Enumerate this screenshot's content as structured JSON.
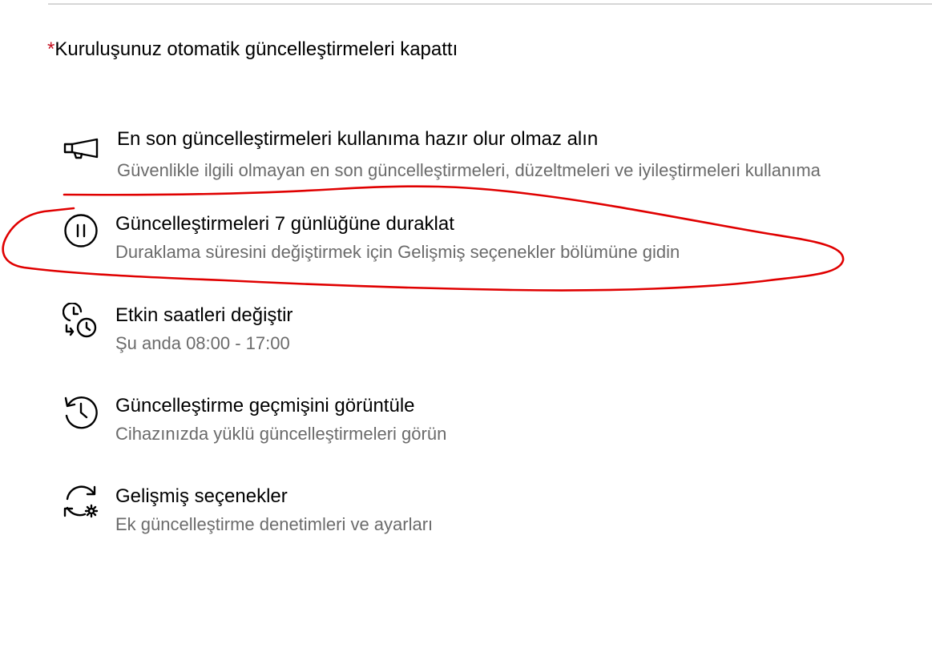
{
  "notice": {
    "asterisk": "*",
    "text": "Kuruluşunuz otomatik güncelleştirmeleri kapattı"
  },
  "options": [
    {
      "icon": "megaphone-icon",
      "title": "En son güncelleştirmeleri kullanıma hazır olur olmaz alın",
      "description": "Güvenlikle ilgili olmayan en son güncelleştirmeleri, düzeltmeleri ve iyileştirmeleri kullanıma"
    },
    {
      "icon": "pause-icon",
      "title": "Güncelleştirmeleri 7 günlüğüne duraklat",
      "description": "Duraklama süresini değiştirmek için Gelişmiş seçenekler bölümüne gidin"
    },
    {
      "icon": "active-hours-icon",
      "title": "Etkin saatleri değiştir",
      "description": "Şu anda 08:00 - 17:00"
    },
    {
      "icon": "history-icon",
      "title": "Güncelleştirme geçmişini görüntüle",
      "description": "Cihazınızda yüklü güncelleştirmeleri görün"
    },
    {
      "icon": "advanced-sync-gear-icon",
      "title": "Gelişmiş seçenekler",
      "description": "Ek güncelleştirme denetimleri ve ayarları"
    }
  ],
  "colors": {
    "asterisk": "#c50f1f",
    "description_text": "#6b6b6b",
    "annotation_ink": "#e00000"
  }
}
